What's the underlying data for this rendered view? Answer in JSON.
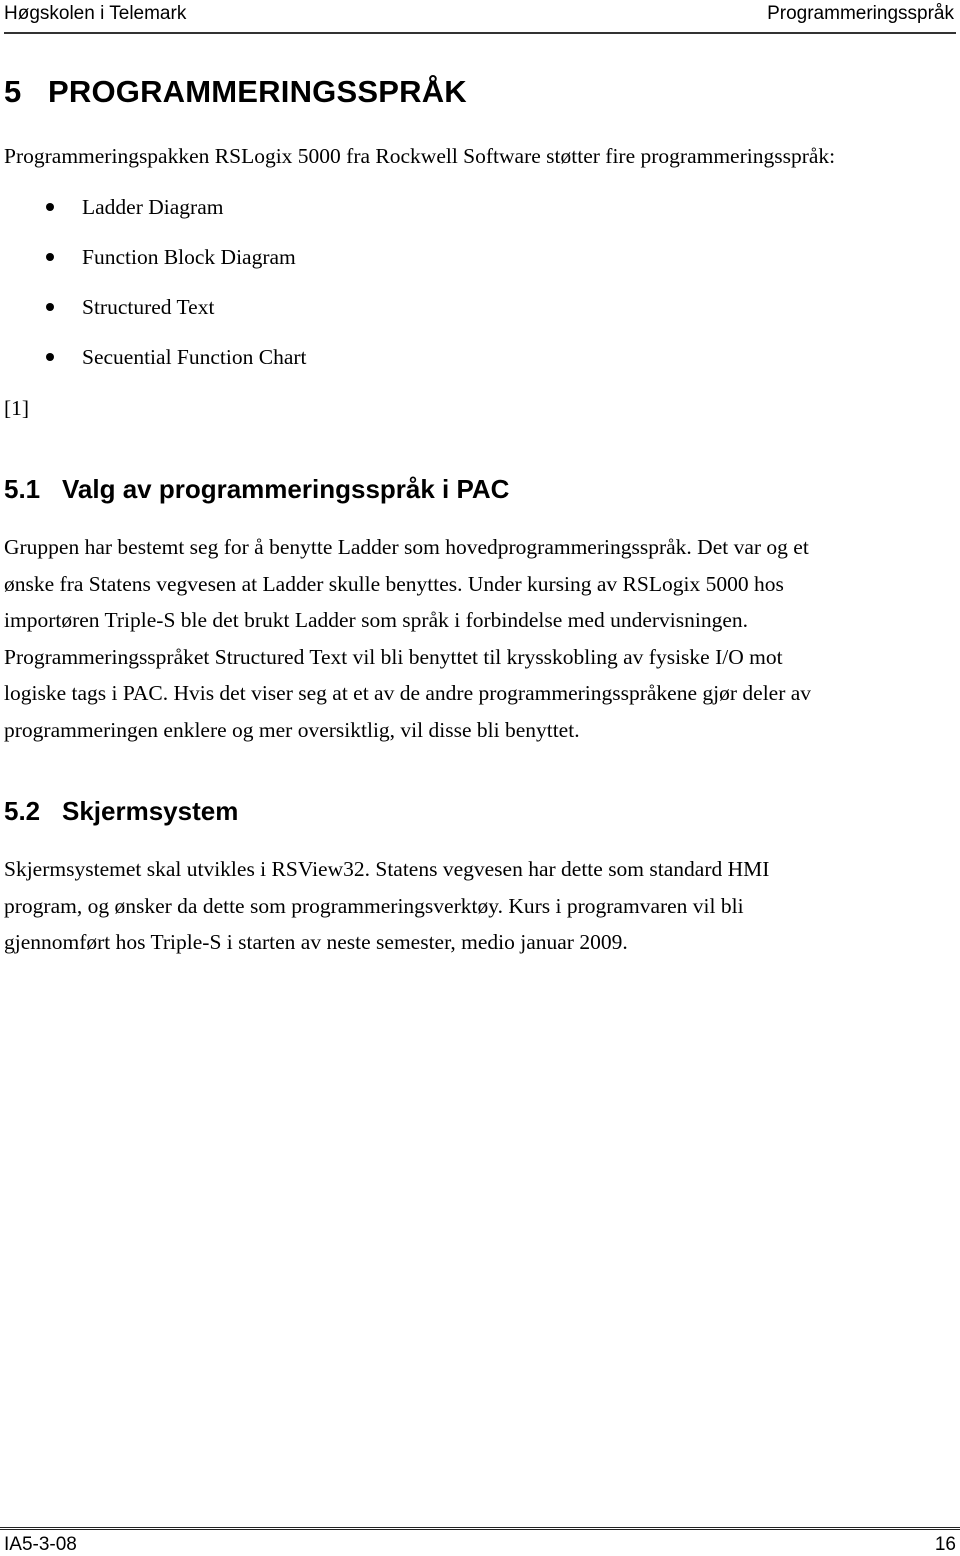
{
  "header": {
    "left": "Høgskolen i Telemark",
    "right": "Programmeringsspråk"
  },
  "chapter": {
    "number": "5",
    "title": "PROGRAMMERINGSSPRÅK",
    "intro": "Programmeringspakken RSLogix 5000 fra Rockwell Software støtter fire programmeringsspråk:",
    "bullets": [
      "Ladder Diagram",
      "Function Block Diagram",
      "Structured Text",
      "Secuential Function Chart"
    ],
    "reference": "[1]"
  },
  "sections": [
    {
      "number": "5.1",
      "title": "Valg av programmeringsspråk i PAC",
      "lines": [
        "Gruppen har bestemt seg for å benytte Ladder som hovedprogrammeringsspråk. Det var og et",
        "ønske fra Statens vegvesen at Ladder skulle benyttes. Under kursing av RSLogix 5000 hos",
        "importøren Triple-S ble det brukt Ladder som språk i forbindelse med undervisningen.",
        "Programmeringsspråket Structured Text vil bli benyttet til krysskobling av fysiske I/O mot",
        "logiske tags i PAC. Hvis det viser seg at et av de andre programmeringsspråkene gjør deler av",
        "programmeringen enklere og mer oversiktlig, vil disse bli benyttet."
      ]
    },
    {
      "number": "5.2",
      "title": "Skjermsystem",
      "lines": [
        "Skjermsystemet skal utvikles i RSView32. Statens vegvesen har dette som standard HMI",
        "program, og ønsker da dette som programmeringsverktøy. Kurs i programvaren vil bli",
        "gjennomført hos Triple-S i starten av neste semester, medio januar 2009."
      ]
    }
  ],
  "footer": {
    "left": "IA5-3-08",
    "page_number": "16"
  }
}
